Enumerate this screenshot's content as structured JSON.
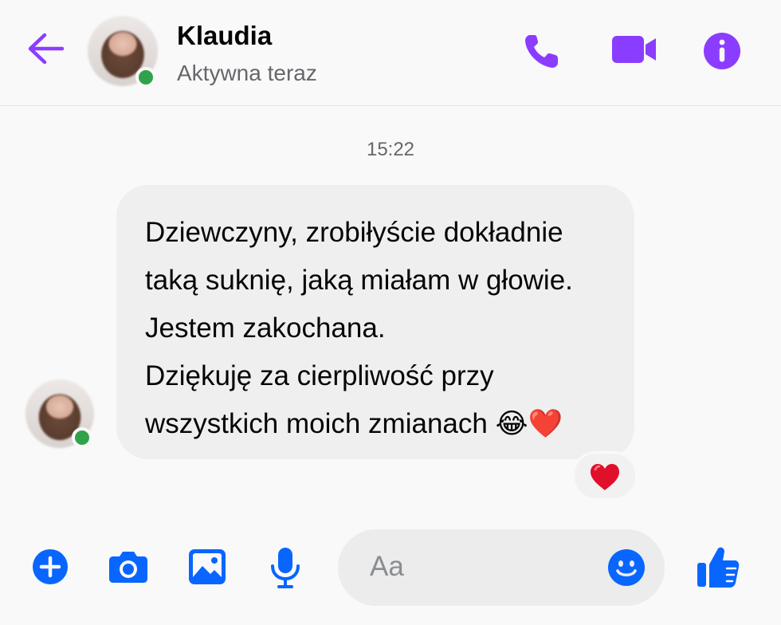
{
  "header": {
    "contact_name": "Klaudia",
    "status": "Aktywna teraz",
    "icons": {
      "back": "arrow-left-icon",
      "call": "phone-icon",
      "video": "video-camera-icon",
      "info": "info-icon"
    }
  },
  "conversation": {
    "timestamp": "15:22",
    "messages": [
      {
        "sender": "Klaudia",
        "lines": [
          "Dziewczyny, zrobiłyście dokładnie",
          "taką suknię, jaką miałam w głowie.",
          "Jestem zakochana.",
          "Dziękuję za cierpliwość przy",
          "wszystkich moich zmianach 😂❤️"
        ],
        "reaction": "❤️"
      }
    ]
  },
  "composer": {
    "placeholder": "Aa",
    "icons": {
      "add": "plus-circle-icon",
      "camera": "camera-icon",
      "gallery": "image-icon",
      "microphone": "microphone-icon",
      "emoji": "smiley-icon",
      "like": "thumbs-up-icon"
    }
  },
  "colors": {
    "header_accent": "#8b3dff",
    "composer_accent": "#0866ff",
    "online": "#31a24c",
    "bubble": "#efefef",
    "reaction_heart": "#e0102a"
  }
}
